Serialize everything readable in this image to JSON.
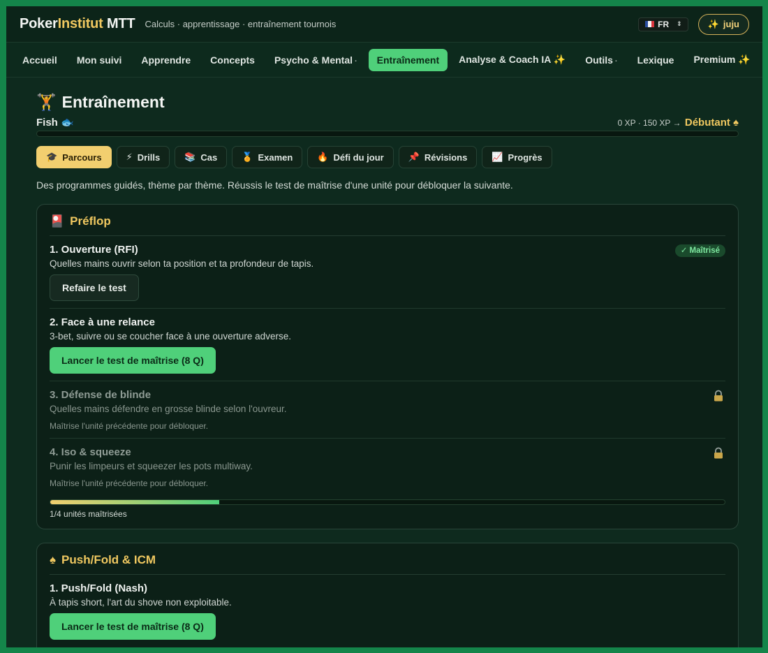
{
  "header": {
    "logo_part1": "Poker",
    "logo_part2": "Institut",
    "logo_part3": " MTT",
    "tagline": "Calculs · apprentissage · entraînement tournois",
    "lang": "FR",
    "user_icon": "✨",
    "user": "juju"
  },
  "nav": {
    "items": [
      {
        "label": "Accueil"
      },
      {
        "label": "Mon suivi"
      },
      {
        "label": "Apprendre"
      },
      {
        "label": "Concepts"
      },
      {
        "label": "Psycho & Mental",
        "dot": "·"
      },
      {
        "label": "Entraînement",
        "active": true
      },
      {
        "label": "Analyse & Coach IA ✨"
      },
      {
        "label": "Outils",
        "dot": "·"
      },
      {
        "label": "Lexique"
      },
      {
        "label": "Premium ✨"
      }
    ]
  },
  "page": {
    "title_icon": "🏋",
    "title": "Entraînement",
    "level_name": "Fish",
    "level_icon": "🐟",
    "xp_text": "0 XP · 150 XP →",
    "rank": "Débutant",
    "rank_icon": "♠",
    "intro": "Des programmes guidés, thème par thème. Réussis le test de maîtrise d'une unité pour débloquer la suivante."
  },
  "tabs": [
    {
      "icon": "🎓",
      "label": "Parcours",
      "active": true
    },
    {
      "icon": "⚡",
      "label": "Drills"
    },
    {
      "icon": "📚",
      "label": "Cas"
    },
    {
      "icon": "🏅",
      "label": "Examen"
    },
    {
      "icon": "🔥",
      "label": "Défi du jour"
    },
    {
      "icon": "📌",
      "label": "Révisions"
    },
    {
      "icon": "📈",
      "label": "Progrès"
    }
  ],
  "sections": {
    "preflop": {
      "icon": "🎴",
      "title": "Préflop",
      "units": [
        {
          "title": "1. Ouverture (RFI)",
          "desc": "Quelles mains ouvrir selon ta position et ta profondeur de tapis.",
          "badge": "✓ Maîtrisé",
          "button": "Refaire le test"
        },
        {
          "title": "2. Face à une relance",
          "desc": "3-bet, suivre ou se coucher face à une ouverture adverse.",
          "button": "Lancer le test de maîtrise (8 Q)"
        },
        {
          "title": "3. Défense de blinde",
          "desc": "Quelles mains défendre en grosse blinde selon l'ouvreur.",
          "note": "Maîtrise l'unité précédente pour débloquer."
        },
        {
          "title": "4. Iso & squeeze",
          "desc": "Punir les limpeurs et squeezer les pots multiway.",
          "note": "Maîtrise l'unité précédente pour débloquer."
        }
      ],
      "progress": 0.25,
      "progress_label": "1/4 unités maîtrisées"
    },
    "pushfold": {
      "icon": "♠",
      "title": "Push/Fold & ICM",
      "units": [
        {
          "title": "1. Push/Fold (Nash)",
          "desc": "À tapis short, l'art du shove non exploitable.",
          "button": "Lancer le test de maîtrise (8 Q)"
        }
      ]
    }
  },
  "colors": {
    "accent_green": "#4fd07a",
    "accent_gold": "#f0c860",
    "background": "#0e2a1e"
  }
}
